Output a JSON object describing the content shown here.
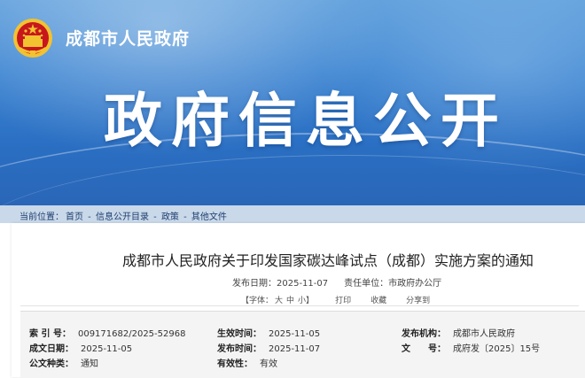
{
  "header": {
    "site_name": "成都市人民政府",
    "hero_title": "政府信息公开",
    "emblem_icon": "national-emblem-icon"
  },
  "breadcrumb": {
    "prefix": "当前位置：",
    "items": [
      "首页",
      "信息公开目录",
      "政策",
      "其他文件"
    ],
    "separator": " - "
  },
  "article": {
    "title": "成都市人民政府关于印发国家碳达峰试点（成都）实施方案的通知",
    "publish_label": "发布日期：",
    "publish_date": "2025-11-07",
    "unit_label": "责任单位：",
    "unit": "市政府办公厅",
    "font_label": "【字体：",
    "font_large": "大",
    "font_medium": "中",
    "font_small": "小】",
    "print_label": "打印",
    "favorite_label": "收藏",
    "share_label": "分享到"
  },
  "info": {
    "row1": {
      "index_key": "索 引 号：",
      "index_val": "009171682/2025-52968",
      "effective_key": "生效时间：",
      "effective_val": "2025-11-05",
      "issuer_key": "发布机构：",
      "issuer_val": "成都市人民政府"
    },
    "row2": {
      "written_key": "成文日期：",
      "written_val": "2025-11-05",
      "published_key": "发布时间：",
      "published_val": "2025-11-07",
      "docno_key": "文　　号：",
      "docno_val": "成府发〔2025〕15号"
    },
    "row3": {
      "type_key": "公文种类：",
      "type_val": "通知",
      "validity_key": "有效性：",
      "validity_val": "有效"
    }
  },
  "colors": {
    "banner": "#3f86d2",
    "breadcrumb_bar": "#c9d9ea",
    "info_bg": "#f4f4f4"
  }
}
